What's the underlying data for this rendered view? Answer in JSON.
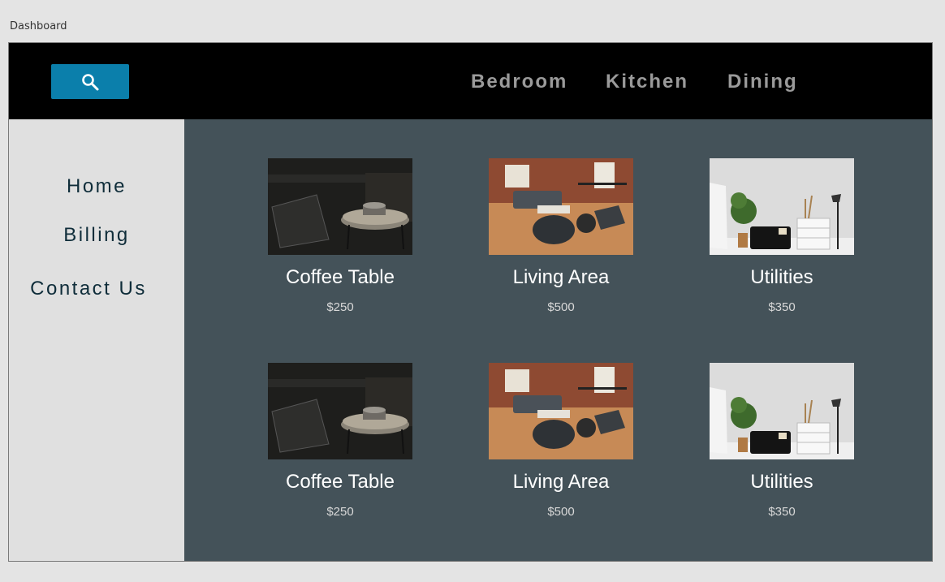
{
  "window": {
    "title": "Dashboard"
  },
  "topbar": {
    "search_icon": "search-icon",
    "nav": [
      "Bedroom",
      "Kitchen",
      "Dining"
    ]
  },
  "sidebar": {
    "items": [
      "Home",
      "Billing",
      "Contact Us"
    ]
  },
  "products": [
    {
      "name": "Coffee Table",
      "price": "$250",
      "image": "coffee-table-image"
    },
    {
      "name": "Living Area",
      "price": "$500",
      "image": "living-area-image"
    },
    {
      "name": "Utilities",
      "price": "$350",
      "image": "utilities-image"
    },
    {
      "name": "Coffee Table",
      "price": "$250",
      "image": "coffee-table-image"
    },
    {
      "name": "Living Area",
      "price": "$500",
      "image": "living-area-image"
    },
    {
      "name": "Utilities",
      "price": "$350",
      "image": "utilities-image"
    }
  ],
  "colors": {
    "topbar": "#000000",
    "search_button": "#0b7fab",
    "main_panel": "#445259",
    "sidebar": "#e0e0e0",
    "sidebar_text": "#0f2d3a",
    "nav_text": "#9a9a9a"
  }
}
